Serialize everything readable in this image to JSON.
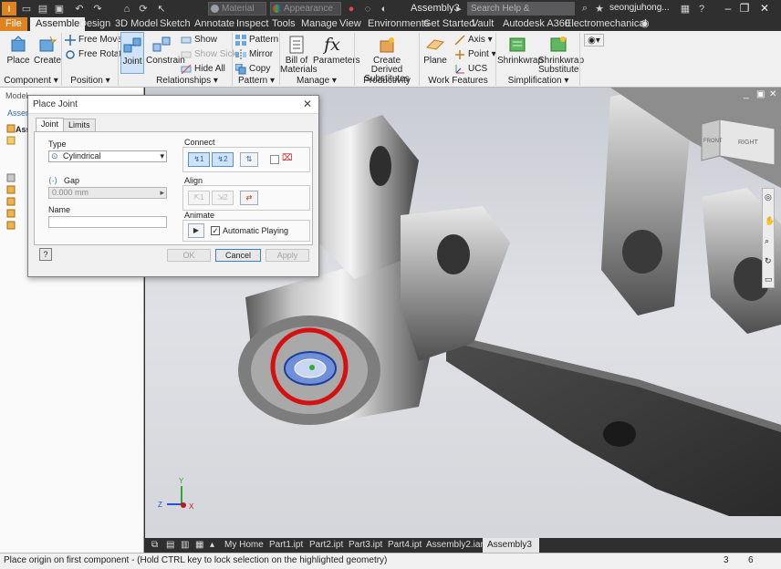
{
  "app": {
    "window_title": "Assembly3",
    "material_placeholder": "Material",
    "appearance_placeholder": "Appearance",
    "search_placeholder": "Search Help & Commands...",
    "user_name": "seongjuhong..."
  },
  "ribbon_tabs": [
    "File",
    "Assemble",
    "Design",
    "3D Model",
    "Sketch",
    "Annotate",
    "Inspect",
    "Tools",
    "Manage",
    "View",
    "Environments",
    "Get Started",
    "Vault",
    "Autodesk A360",
    "Electromechanical"
  ],
  "ribbon": {
    "component": {
      "place": "Place",
      "create": "Create",
      "panel": "Component"
    },
    "position": {
      "free_move": "Free Move",
      "free_rotate": "Free Rotate",
      "panel": "Position"
    },
    "relationships": {
      "joint": "Joint",
      "constrain": "Constrain",
      "show": "Show",
      "show_sick": "Show Sick",
      "hide_all": "Hide All",
      "panel": "Relationships"
    },
    "pattern": {
      "pattern": "Pattern",
      "mirror": "Mirror",
      "copy": "Copy",
      "panel": "Pattern"
    },
    "manage": {
      "bill_of": "Bill of",
      "materials": "Materials",
      "parameters": "Parameters",
      "panel": "Manage"
    },
    "productivity": {
      "create_derived": "Create Derived",
      "substitutes": "Substitutes",
      "panel": "Productivity"
    },
    "work_features": {
      "plane": "Plane",
      "axis": "Axis",
      "point": "Point",
      "ucs": "UCS",
      "panel": "Work Features"
    },
    "simplification": {
      "shrinkwrap": "Shrinkwrap",
      "shrinkwrap2": "Shrinkwrap",
      "substitute": "Substitute",
      "panel": "Simplification"
    }
  },
  "browser": {
    "model_label": "Model",
    "assembly_label": "Assem",
    "root_label": "Ass"
  },
  "dialog": {
    "title": "Place Joint",
    "tabs": [
      "Joint",
      "Limits"
    ],
    "type_label": "Type",
    "type_value": "Cylindrical",
    "gap_label": "Gap",
    "gap_value": "0.000 mm",
    "name_label": "Name",
    "name_value": "",
    "connect_label": "Connect",
    "align_label": "Align",
    "animate_label": "Animate",
    "automatic_playing": "Automatic Playing",
    "automatic_playing_checked": true,
    "btn_ok": "OK",
    "btn_cancel": "Cancel",
    "btn_apply": "Apply",
    "help": "?"
  },
  "viewcube": {
    "front": "FRONT",
    "right": "RIGHT"
  },
  "doc_tabs": [
    "My Home",
    "Part1.ipt",
    "Part2.ipt",
    "Part3.ipt",
    "Part4.ipt",
    "Assembly2.iam",
    "Assembly3"
  ],
  "active_doc_tab": "Assembly3",
  "status": {
    "message": "Place origin on first component - (Hold CTRL key to lock selection on the highlighted geometry)",
    "count1": "3",
    "count2": "6"
  },
  "triad": {
    "x": "X",
    "y": "Y",
    "z": "Z"
  },
  "colors": {
    "accent": "#e0821d",
    "highlight_circle": "#d41010",
    "selection": "#3c7fc6"
  }
}
